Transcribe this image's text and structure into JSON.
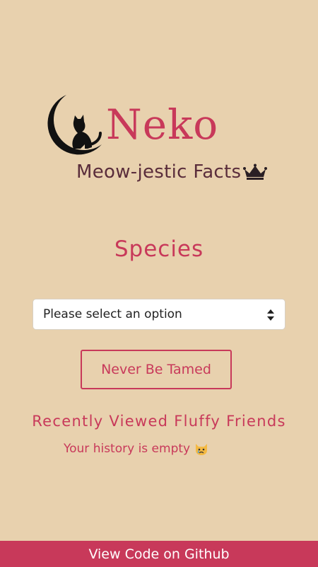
{
  "header": {
    "title": "Neko",
    "subtitle": "Meow-jestic Facts",
    "logo_icon": "cat-on-moon-icon",
    "crown_icon": "crown-icon"
  },
  "main": {
    "heading": "Species",
    "select": {
      "selected": "Please select an option"
    },
    "button_label": "Never Be Tamed",
    "recent_heading": "Recently Viewed Fluffy Friends",
    "history_empty": "Your history is empty",
    "history_icon": "crying-cat-face-icon"
  },
  "footer": {
    "link": "View Code on Github"
  },
  "colors": {
    "background": "#e8d1ae",
    "accent": "#c8395a",
    "subtitle": "#5a2d3b"
  }
}
